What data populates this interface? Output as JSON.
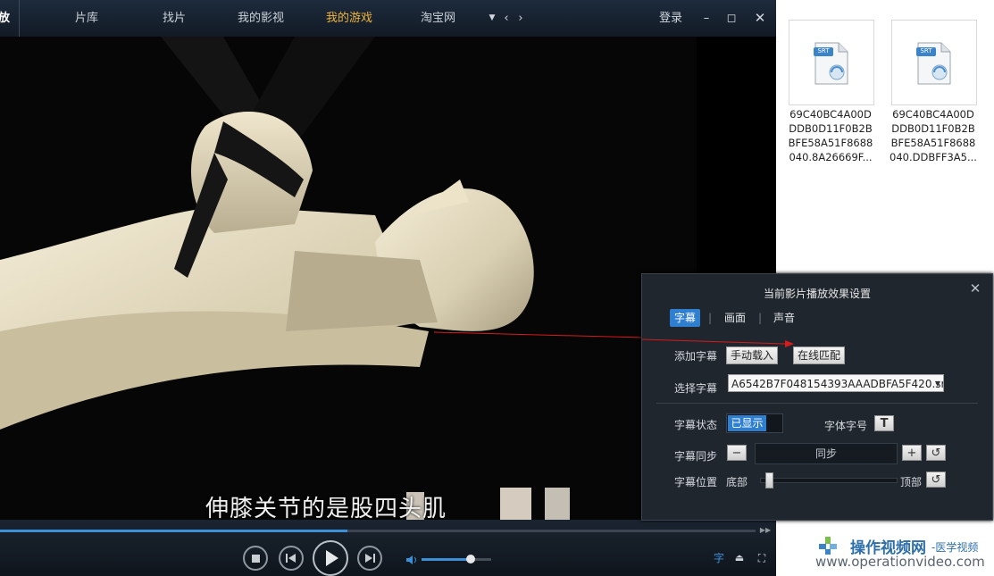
{
  "nav": {
    "tabs": [
      {
        "label": "放"
      },
      {
        "label": "片库"
      },
      {
        "label": "找片"
      },
      {
        "label": "我的影视"
      },
      {
        "label": "我的游戏"
      },
      {
        "label": "淘宝网"
      }
    ],
    "active_tab": "我的游戏",
    "login": "登录",
    "more_icon": "dropdown-caret-icon",
    "prev_icon": "chevron-left-icon",
    "next_icon": "chevron-right-icon",
    "minimize_icon": "minimize-icon",
    "maximize_icon": "maximize-icon",
    "close_icon": "close-icon"
  },
  "video": {
    "subtitle": "伸膝关节的是股四头肌"
  },
  "controls": {
    "progress": 0.46,
    "volume": 0.7,
    "subtitle_button": "字",
    "colors": {
      "accent": "#3d8fd8",
      "bar_bg": "#121a25"
    }
  },
  "fx_panel": {
    "title": "当前影片播放效果设置",
    "tabs": [
      {
        "label": "字幕"
      },
      {
        "label": "画面"
      },
      {
        "label": "声音"
      }
    ],
    "active_tab": "字幕",
    "add_subtitle": {
      "label": "添加字幕",
      "manual_button": "手动载入",
      "online_button": "在线匹配"
    },
    "select_subtitle": {
      "label": "选择字幕",
      "value": "A6542B7F048154393AAADBFA5F420.srt"
    },
    "status": {
      "label": "字幕状态",
      "toggle_label": "已显示",
      "font_label": "字体字号",
      "font_button": "T"
    },
    "sync": {
      "label": "字幕同步",
      "value": "同步"
    },
    "position": {
      "label": "字幕位置",
      "min_label": "底部",
      "max_label": "顶部",
      "value": 0.02
    }
  },
  "files": [
    {
      "badge": "SRT",
      "name": "69C40BC4A00DDDB0D11F0B2BBFE58A51F8688040.8A26669F..."
    },
    {
      "badge": "SRT",
      "name": "69C40BC4A00DDDB0D11F0B2BBFE58A51F8688040.DDBFF3A5..."
    }
  ],
  "watermark": {
    "title": "操作视频网",
    "subtitle": "-医学视频",
    "url": "www.operationvideo.com"
  }
}
